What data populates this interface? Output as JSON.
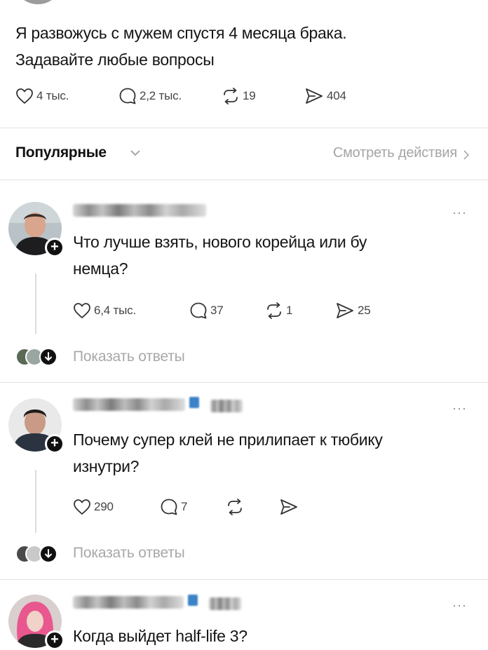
{
  "post": {
    "lines": [
      "Я развожусь с мужем спустя 4 месяца брака.",
      "Задавайте любые вопросы"
    ],
    "likes": "4 тыс.",
    "replies": "2,2 тыс.",
    "reposts": "19",
    "shares": "404"
  },
  "sort": {
    "label": "Популярные",
    "view_activity": "Смотреть действия"
  },
  "comments": [
    {
      "lines": [
        "Что лучше взять, нового корейца или бу",
        "немца?"
      ],
      "likes": "6,4 тыс.",
      "replies": "37",
      "reposts": "1",
      "shares": "25",
      "show_replies": "Показать ответы"
    },
    {
      "lines": [
        "Почему супер клей не прилипает к тюбику",
        "изнутри?"
      ],
      "likes": "290",
      "replies": "7",
      "reposts": "",
      "shares": "",
      "show_replies": "Показать ответы"
    },
    {
      "lines": [
        "Когда выйдет half-life 3?"
      ]
    }
  ],
  "icons": {
    "like": "heart-icon",
    "reply": "comment-bubble-icon",
    "repost": "repost-icon",
    "share": "send-icon",
    "more": "more-options-icon",
    "follow": "plus-icon",
    "chevron": "chevron-icon"
  },
  "colors": {
    "text": "#151515",
    "muted": "#a8a8a8",
    "badge": "#111111",
    "verified": "#3b82c7"
  }
}
